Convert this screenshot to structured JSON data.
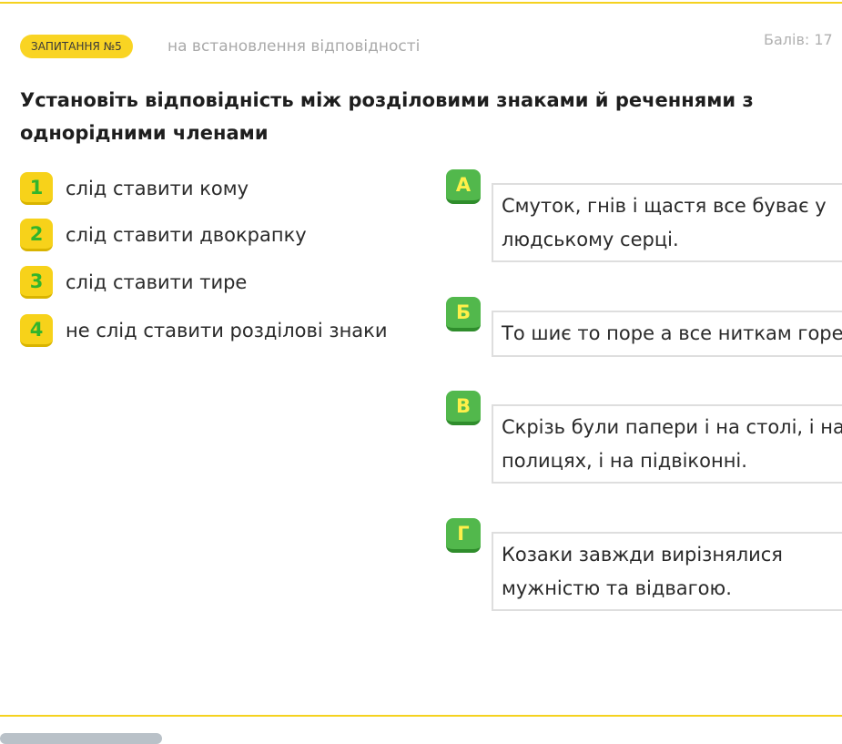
{
  "header": {
    "question_badge": "ЗАПИТАННЯ №5",
    "question_type": "на встановлення відповідності",
    "score": "Балів: 17"
  },
  "question": {
    "text": "Установіть відповідність між розділовими знаками й реченнями з однорідними членами"
  },
  "left_items": [
    {
      "key": "1",
      "label": "слід ставити кому"
    },
    {
      "key": "2",
      "label": "слід ставити двокрапку"
    },
    {
      "key": "3",
      "label": "слід ставити тире"
    },
    {
      "key": "4",
      "label": "не слід ставити розділові знаки"
    }
  ],
  "right_items": [
    {
      "key": "А",
      "text": "Смуток, гнів і щастя все буває у людському серці."
    },
    {
      "key": "Б",
      "text": "То шиє то поре а все ниткам горе."
    },
    {
      "key": "В",
      "text": "Скрізь були папери і на столі, і на полицях, і на підвіконні."
    },
    {
      "key": "Г",
      "text": "Козаки завжди вирізнялися мужністю та відвагою."
    }
  ],
  "colors": {
    "accent_yellow": "#f9d423",
    "key_green": "#52b84c",
    "key_number_green": "#32b52c",
    "key_letter_yellow": "#fff04a",
    "muted_text": "#a9a9a9"
  }
}
